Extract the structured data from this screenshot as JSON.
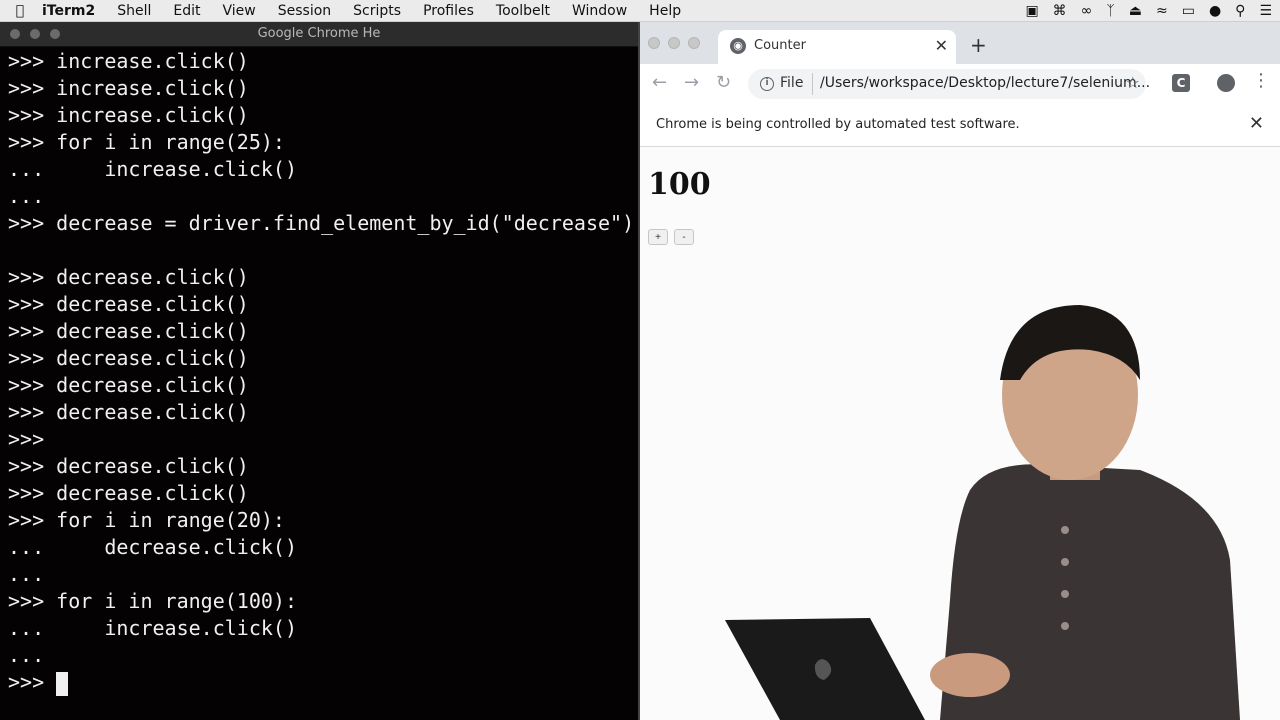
{
  "menubar": {
    "items": [
      "iTerm2",
      "Shell",
      "Edit",
      "View",
      "Session",
      "Scripts",
      "Profiles",
      "Toolbelt",
      "Window",
      "Help"
    ]
  },
  "terminal": {
    "title": "Google Chrome He",
    "lines": [
      {
        "prompt": ">>>",
        "code": " increase.click()"
      },
      {
        "prompt": ">>>",
        "code": " increase.click()"
      },
      {
        "prompt": ">>>",
        "code": " increase.click()"
      },
      {
        "prompt": ">>>",
        "code": " for i in range(25):"
      },
      {
        "prompt": "...",
        "code": "     increase.click()"
      },
      {
        "prompt": "...",
        "code": ""
      },
      {
        "prompt": ">>>",
        "code": " decrease = driver.find_element_by_id(\"decrease\")"
      },
      {
        "prompt": "",
        "code": ""
      },
      {
        "prompt": ">>>",
        "code": " decrease.click()"
      },
      {
        "prompt": ">>>",
        "code": " decrease.click()"
      },
      {
        "prompt": ">>>",
        "code": " decrease.click()"
      },
      {
        "prompt": ">>>",
        "code": " decrease.click()"
      },
      {
        "prompt": ">>>",
        "code": " decrease.click()"
      },
      {
        "prompt": ">>>",
        "code": " decrease.click()"
      },
      {
        "prompt": ">>>",
        "code": ""
      },
      {
        "prompt": ">>>",
        "code": " decrease.click()"
      },
      {
        "prompt": ">>>",
        "code": " decrease.click()"
      },
      {
        "prompt": ">>>",
        "code": " for i in range(20):"
      },
      {
        "prompt": "...",
        "code": "     decrease.click()"
      },
      {
        "prompt": "...",
        "code": ""
      },
      {
        "prompt": ">>>",
        "code": " for i in range(100):"
      },
      {
        "prompt": "...",
        "code": "     increase.click()"
      },
      {
        "prompt": "...",
        "code": ""
      }
    ],
    "current_prompt": ">>>"
  },
  "chrome": {
    "tab_title": "Counter",
    "scheme": "File",
    "url": "/Users/workspace/Desktop/lecture7/selenium...",
    "ext_label": "C",
    "infobar_message": "Chrome is being controlled by automated test software.",
    "page": {
      "counter": "100",
      "increase_label": "+",
      "decrease_label": "-"
    }
  }
}
